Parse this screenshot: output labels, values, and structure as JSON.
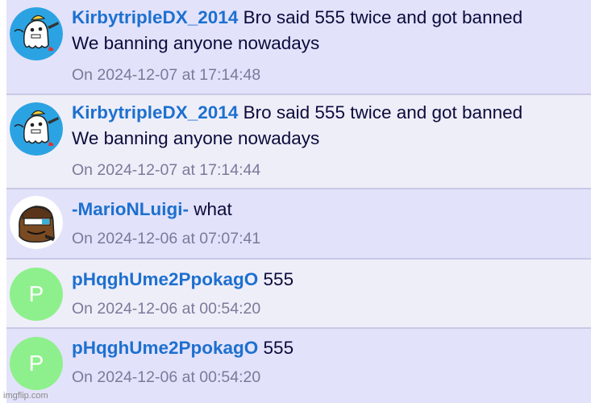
{
  "comments": [
    {
      "username": "KirbytripleDX_2014",
      "avatar_icon": "ghost-mascot-icon",
      "text_line1": "Bro said 555 twice and got banned",
      "text_line2": "We banning anyone nowadays",
      "timestamp": "On 2024-12-07 at 17:14:48"
    },
    {
      "username": "KirbytripleDX_2014",
      "avatar_icon": "ghost-mascot-icon",
      "text_line1": "Bro said 555 twice and got banned",
      "text_line2": "We banning anyone nowadays",
      "timestamp": "On 2024-12-07 at 17:14:44"
    },
    {
      "username": "-MarioNLuigi-",
      "avatar_icon": "brown-character-icon",
      "text_line1": "what",
      "timestamp": "On 2024-12-06 at 07:07:41"
    },
    {
      "username": "pHqghUme2PpokagO",
      "avatar_letter": "P",
      "text_line1": "555",
      "timestamp": "On 2024-12-06 at 00:54:20"
    },
    {
      "username": "pHqghUme2PpokagO",
      "avatar_letter": "P",
      "text_line1": "555",
      "timestamp": "On 2024-12-06 at 00:54:20"
    }
  ],
  "colors": {
    "username": "#1d70cf",
    "row_odd": "#e2e2fb",
    "row_even": "#eeeef9",
    "letter_avatar": "#8ef08c"
  },
  "watermark": "imgflip.com"
}
